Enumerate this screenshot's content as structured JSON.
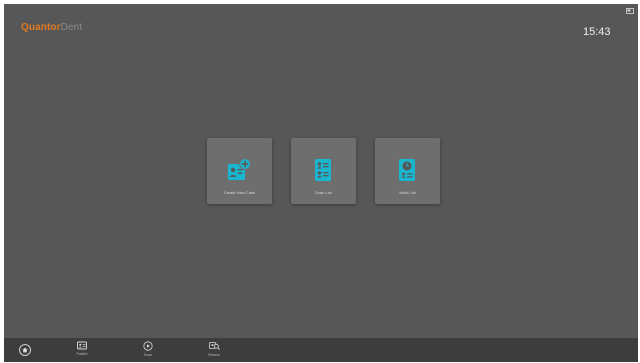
{
  "app": {
    "logo_primary": "Quantor",
    "logo_secondary": "Dent"
  },
  "status": {
    "time": "15:43"
  },
  "tiles": [
    {
      "label": "Create New Case",
      "icon": "add-patient-icon"
    },
    {
      "label": "Scan List",
      "icon": "scan-list-icon"
    },
    {
      "label": "Work List",
      "icon": "work-list-icon"
    }
  ],
  "taskbar": [
    {
      "label": "Patient",
      "icon": "patient-card-icon"
    },
    {
      "label": "Scan",
      "icon": "scan-icon"
    },
    {
      "label": "Review",
      "icon": "review-icon"
    }
  ],
  "colors": {
    "accent": "#e07a22",
    "tile_icon": "#1ab6cf",
    "background": "#575757",
    "taskbar": "#3d3d3d"
  }
}
